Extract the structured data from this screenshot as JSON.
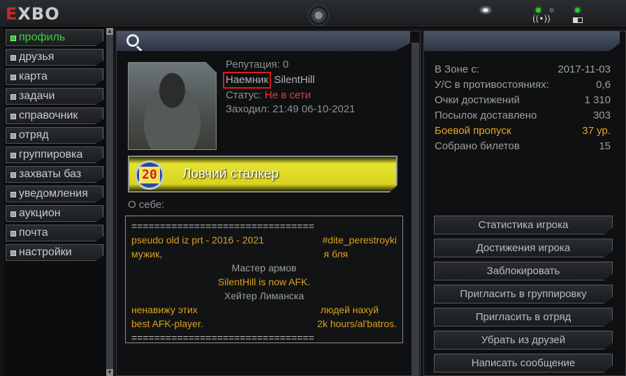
{
  "app": {
    "logo_prefix": "E",
    "logo_rest": "XBO"
  },
  "sidebar": {
    "items": [
      {
        "label": "профиль",
        "active": true
      },
      {
        "label": "друзья"
      },
      {
        "label": "карта"
      },
      {
        "label": "задачи"
      },
      {
        "label": "справочник"
      },
      {
        "label": "отряд"
      },
      {
        "label": "группировка"
      },
      {
        "label": "захваты баз"
      },
      {
        "label": "уведомления"
      },
      {
        "label": "аукцион"
      },
      {
        "label": "почта"
      },
      {
        "label": "настройки"
      }
    ]
  },
  "profile": {
    "reputation": "Репутация: 0",
    "rank": "Наемник",
    "name": "SilentHill",
    "status_label": "Статус:",
    "status_value": "Не в сети",
    "last_seen": "Заходил: 21:49 06-10-2021",
    "achievement_level": "20",
    "achievement_title": "Ловчий сталкер",
    "about_label": "О себе:"
  },
  "about": {
    "rule_top": "================================",
    "line1_left": "pseudo old iz prt - 2016 - 2021",
    "line1_right": "#dite_perestroyki",
    "line2_left": "мужик,",
    "line2_right": "я бля",
    "line3": "Мастер армов",
    "line4": "SilentHill is now AFK.",
    "line5": "Хейтер Лиманска",
    "line6_left": "ненавижу этих",
    "line6_right": "людей нахуй",
    "line7_left": "best AFK-player.",
    "line7_right": "2k hours/al'batros.",
    "rule_bottom": "================================"
  },
  "stats": [
    {
      "label": "В Зоне с:",
      "value": "2017-11-03"
    },
    {
      "label": "У/С в противостояниях:",
      "value": "0,6"
    },
    {
      "label": "Очки достижений",
      "value": "1 310"
    },
    {
      "label": "Посылок доставлено",
      "value": "303"
    },
    {
      "label": "Боевой пропуск",
      "value": "37 ур.",
      "highlight": true
    },
    {
      "label": "Собрано билетов",
      "value": "15"
    }
  ],
  "actions": [
    "Статистика игрока",
    "Достижения игрока",
    "Заблокировать",
    "Пригласить в группировку",
    "Пригласить в отряд",
    "Убрать из друзей",
    "Написать сообщение"
  ],
  "colors": {
    "accent_green": "#3cd43c",
    "status_red": "#e03c3c",
    "highlight_orange": "#e6a51e",
    "rank_box_red": "#e01b1b"
  }
}
